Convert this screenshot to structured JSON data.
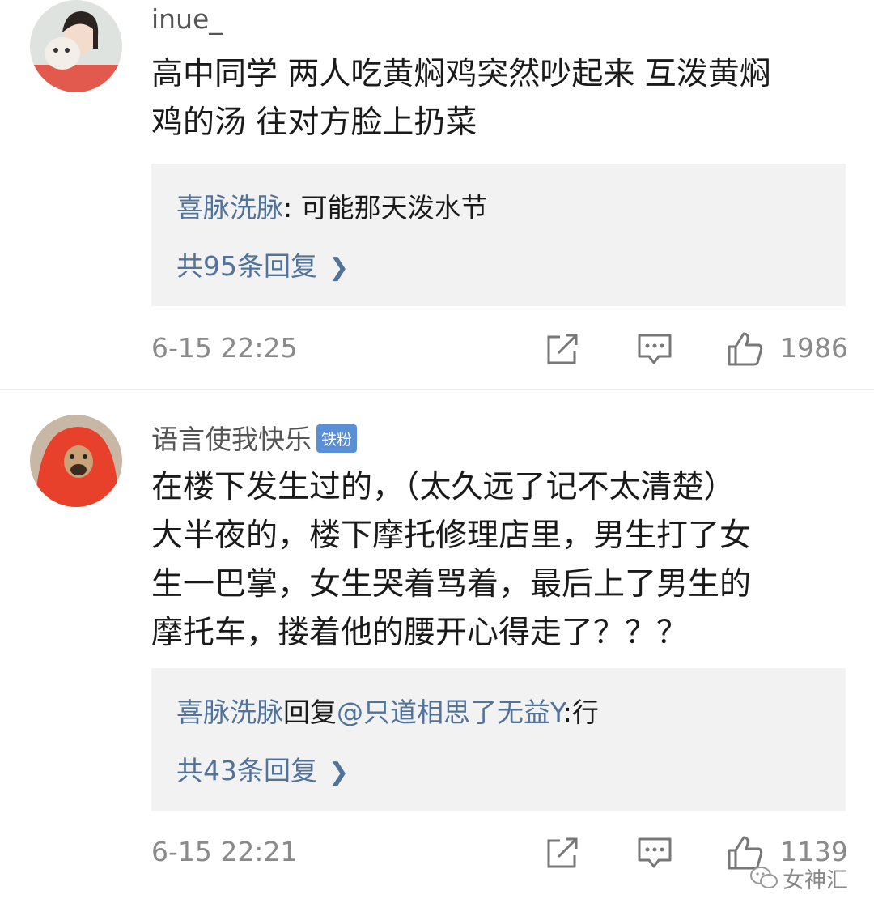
{
  "comments": [
    {
      "username": "inue_",
      "badge": "",
      "text_lines": [
        "高中同学 两人吃黄焖鸡突然吵起来 互泼黄焖",
        "鸡的汤 往对方脸上扔菜"
      ],
      "reply_author": "喜脉洗脉",
      "reply_mid": "",
      "reply_target": "",
      "reply_text": ": 可能那天泼水节",
      "reply_count": "共95条回复",
      "timestamp": "6-15 22:25",
      "likes": "1986"
    },
    {
      "username": "语言使我快乐",
      "badge": "铁粉",
      "text_lines": [
        "在楼下发生过的，（太久远了记不太清楚）",
        "大半夜的，楼下摩托修理店里，男生打了女",
        "生一巴掌，女生哭着骂着，最后上了男生的",
        "摩托车，搂着他的腰开心得走了？？？"
      ],
      "reply_author": "喜脉洗脉",
      "reply_mid": "回复",
      "reply_target": "@只道相思了无益Y",
      "reply_text": ":行",
      "reply_count": "共43条回复",
      "timestamp": "6-15 22:21",
      "likes": "1139"
    }
  ],
  "icons": {
    "share": "share-icon",
    "comment": "comment-icon",
    "like": "thumbs-up-icon",
    "chevron": "chevron-right-icon"
  },
  "watermark": {
    "text": "女神汇"
  },
  "colors": {
    "link": "#51739b",
    "meta": "#8a8a8a",
    "reply_bg": "#f2f2f2",
    "badge": "#5a8fd6"
  }
}
